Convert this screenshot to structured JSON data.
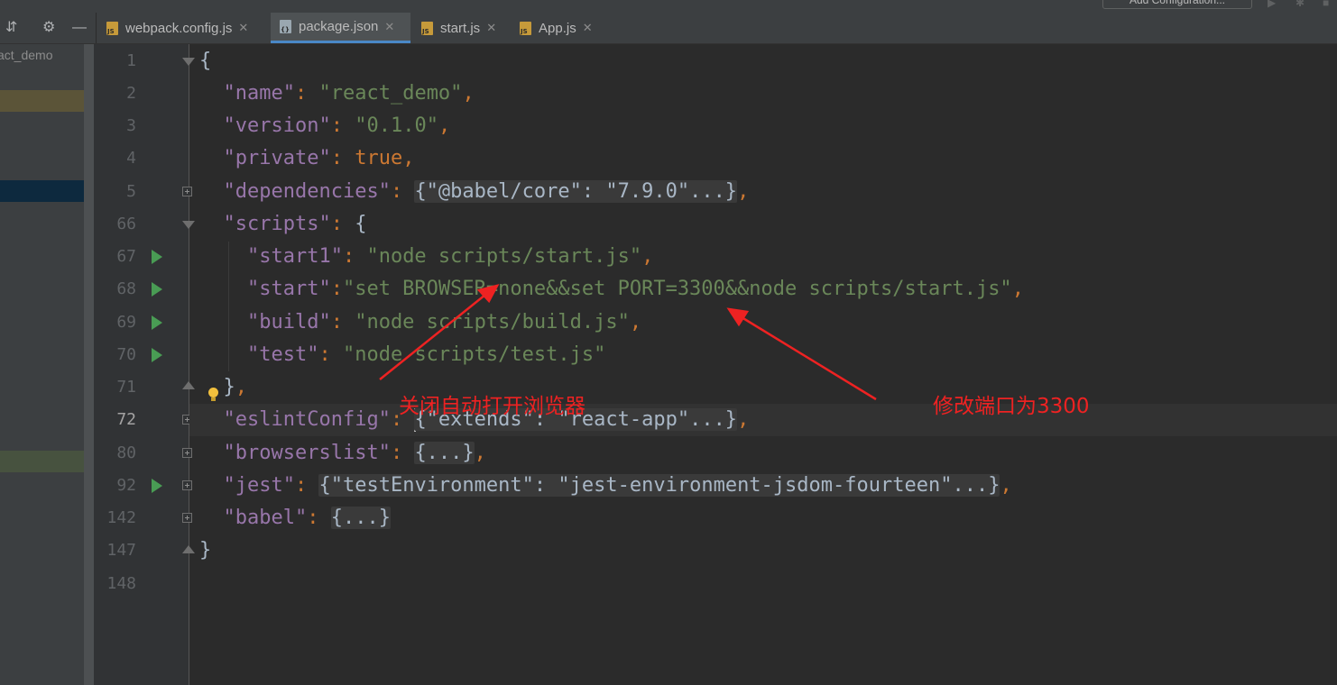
{
  "toolbar": {
    "config_button": "Add Configuration..."
  },
  "project": {
    "name": "act_demo"
  },
  "tabs": [
    {
      "label": "webpack.config.js",
      "icon": "js-file-icon",
      "badge": "JS"
    },
    {
      "label": "package.json",
      "icon": "json-file-icon",
      "badge": "{}"
    },
    {
      "label": "start.js",
      "icon": "js-file-icon",
      "badge": "JS"
    },
    {
      "label": "App.js",
      "icon": "js-file-icon",
      "badge": "JS"
    }
  ],
  "active_tab": "package.json",
  "colors": {
    "key": "#9876aa",
    "string": "#6a8759",
    "punctuation": "#cc7832",
    "run_arrow": "#499c54",
    "annotation": "#ee2222",
    "tab_underline": "#4a88c7"
  },
  "line_numbers": [
    "1",
    "2",
    "3",
    "4",
    "5",
    "66",
    "67",
    "68",
    "69",
    "70",
    "71",
    "72",
    "80",
    "92",
    "142",
    "147",
    "148"
  ],
  "current_line": "72",
  "code": {
    "l1": "{",
    "l2_key": "\"name\"",
    "l2_val": "\"react_demo\"",
    "l3_key": "\"version\"",
    "l3_val": "\"0.1.0\"",
    "l4_key": "\"private\"",
    "l4_val": "true",
    "l5_key": "\"dependencies\"",
    "l5_fold": "{\"@babel/core\": \"7.9.0\"...}",
    "l66_key": "\"scripts\"",
    "l66_brace": "{",
    "l67_key": "\"start1\"",
    "l67_val": "\"node scripts/start.js\"",
    "l68_key": "\"start\"",
    "l68_val": "\"set BROWSER=none&&set PORT=3300&&node scripts/start.js\"",
    "l69_key": "\"build\"",
    "l69_val": "\"node scripts/build.js\"",
    "l70_key": "\"test\"",
    "l70_val": "\"node scripts/test.js\"",
    "l71": "}",
    "l72_key": "\"eslintConfig\"",
    "l72_fold": "{\"extends\": \"react-app\"...}",
    "l80_key": "\"browserslist\"",
    "l80_fold": "{...}",
    "l92_key": "\"jest\"",
    "l92_fold": "{\"testEnvironment\": \"jest-environment-jsdom-fourteen\"...}",
    "l142_key": "\"babel\"",
    "l142_fold": "{...}",
    "l147": "}"
  },
  "annotations": {
    "left": "关闭自动打开浏览器",
    "right": "修改端口为3300"
  }
}
